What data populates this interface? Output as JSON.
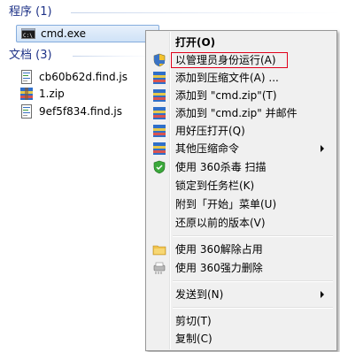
{
  "groups": {
    "programs": {
      "title": "程序 (1)"
    },
    "documents": {
      "title": "文档 (3)"
    }
  },
  "programs": [
    {
      "name": "cmd.exe",
      "icon": "cmd-icon"
    }
  ],
  "documents": [
    {
      "name": "cb60b62d.find.js",
      "icon": "script-file-icon"
    },
    {
      "name": "1.zip",
      "icon": "archive-icon"
    },
    {
      "name": "9ef5f834.find.js",
      "icon": "script-file-icon"
    }
  ],
  "context_menu": {
    "open": "打开(O)",
    "run_as_admin": "以管理员身份运行(A)",
    "add_to_archive": "添加到压缩文件(A) ...",
    "add_to_cmd_zip": "添加到 \"cmd.zip\"(T)",
    "add_to_cmd_zip_mail": "添加到 \"cmd.zip\" 并邮件",
    "open_with_haozip": "用好压打开(Q)",
    "other_compress": "其他压缩命令",
    "scan_360": "使用 360杀毒 扫描",
    "pin_taskbar": "锁定到任务栏(K)",
    "pin_start": "附到「开始」菜单(U)",
    "restore_version": "还原以前的版本(V)",
    "unlock_360": "使用 360解除占用",
    "force_delete_360": "使用 360强力删除",
    "send_to": "发送到(N)",
    "cut": "剪切(T)",
    "copy": "复制(C)"
  },
  "colors": {
    "group_header": "#1e3287",
    "highlight_box": "#e0001a",
    "selection_bg": "#cfe2f7"
  }
}
